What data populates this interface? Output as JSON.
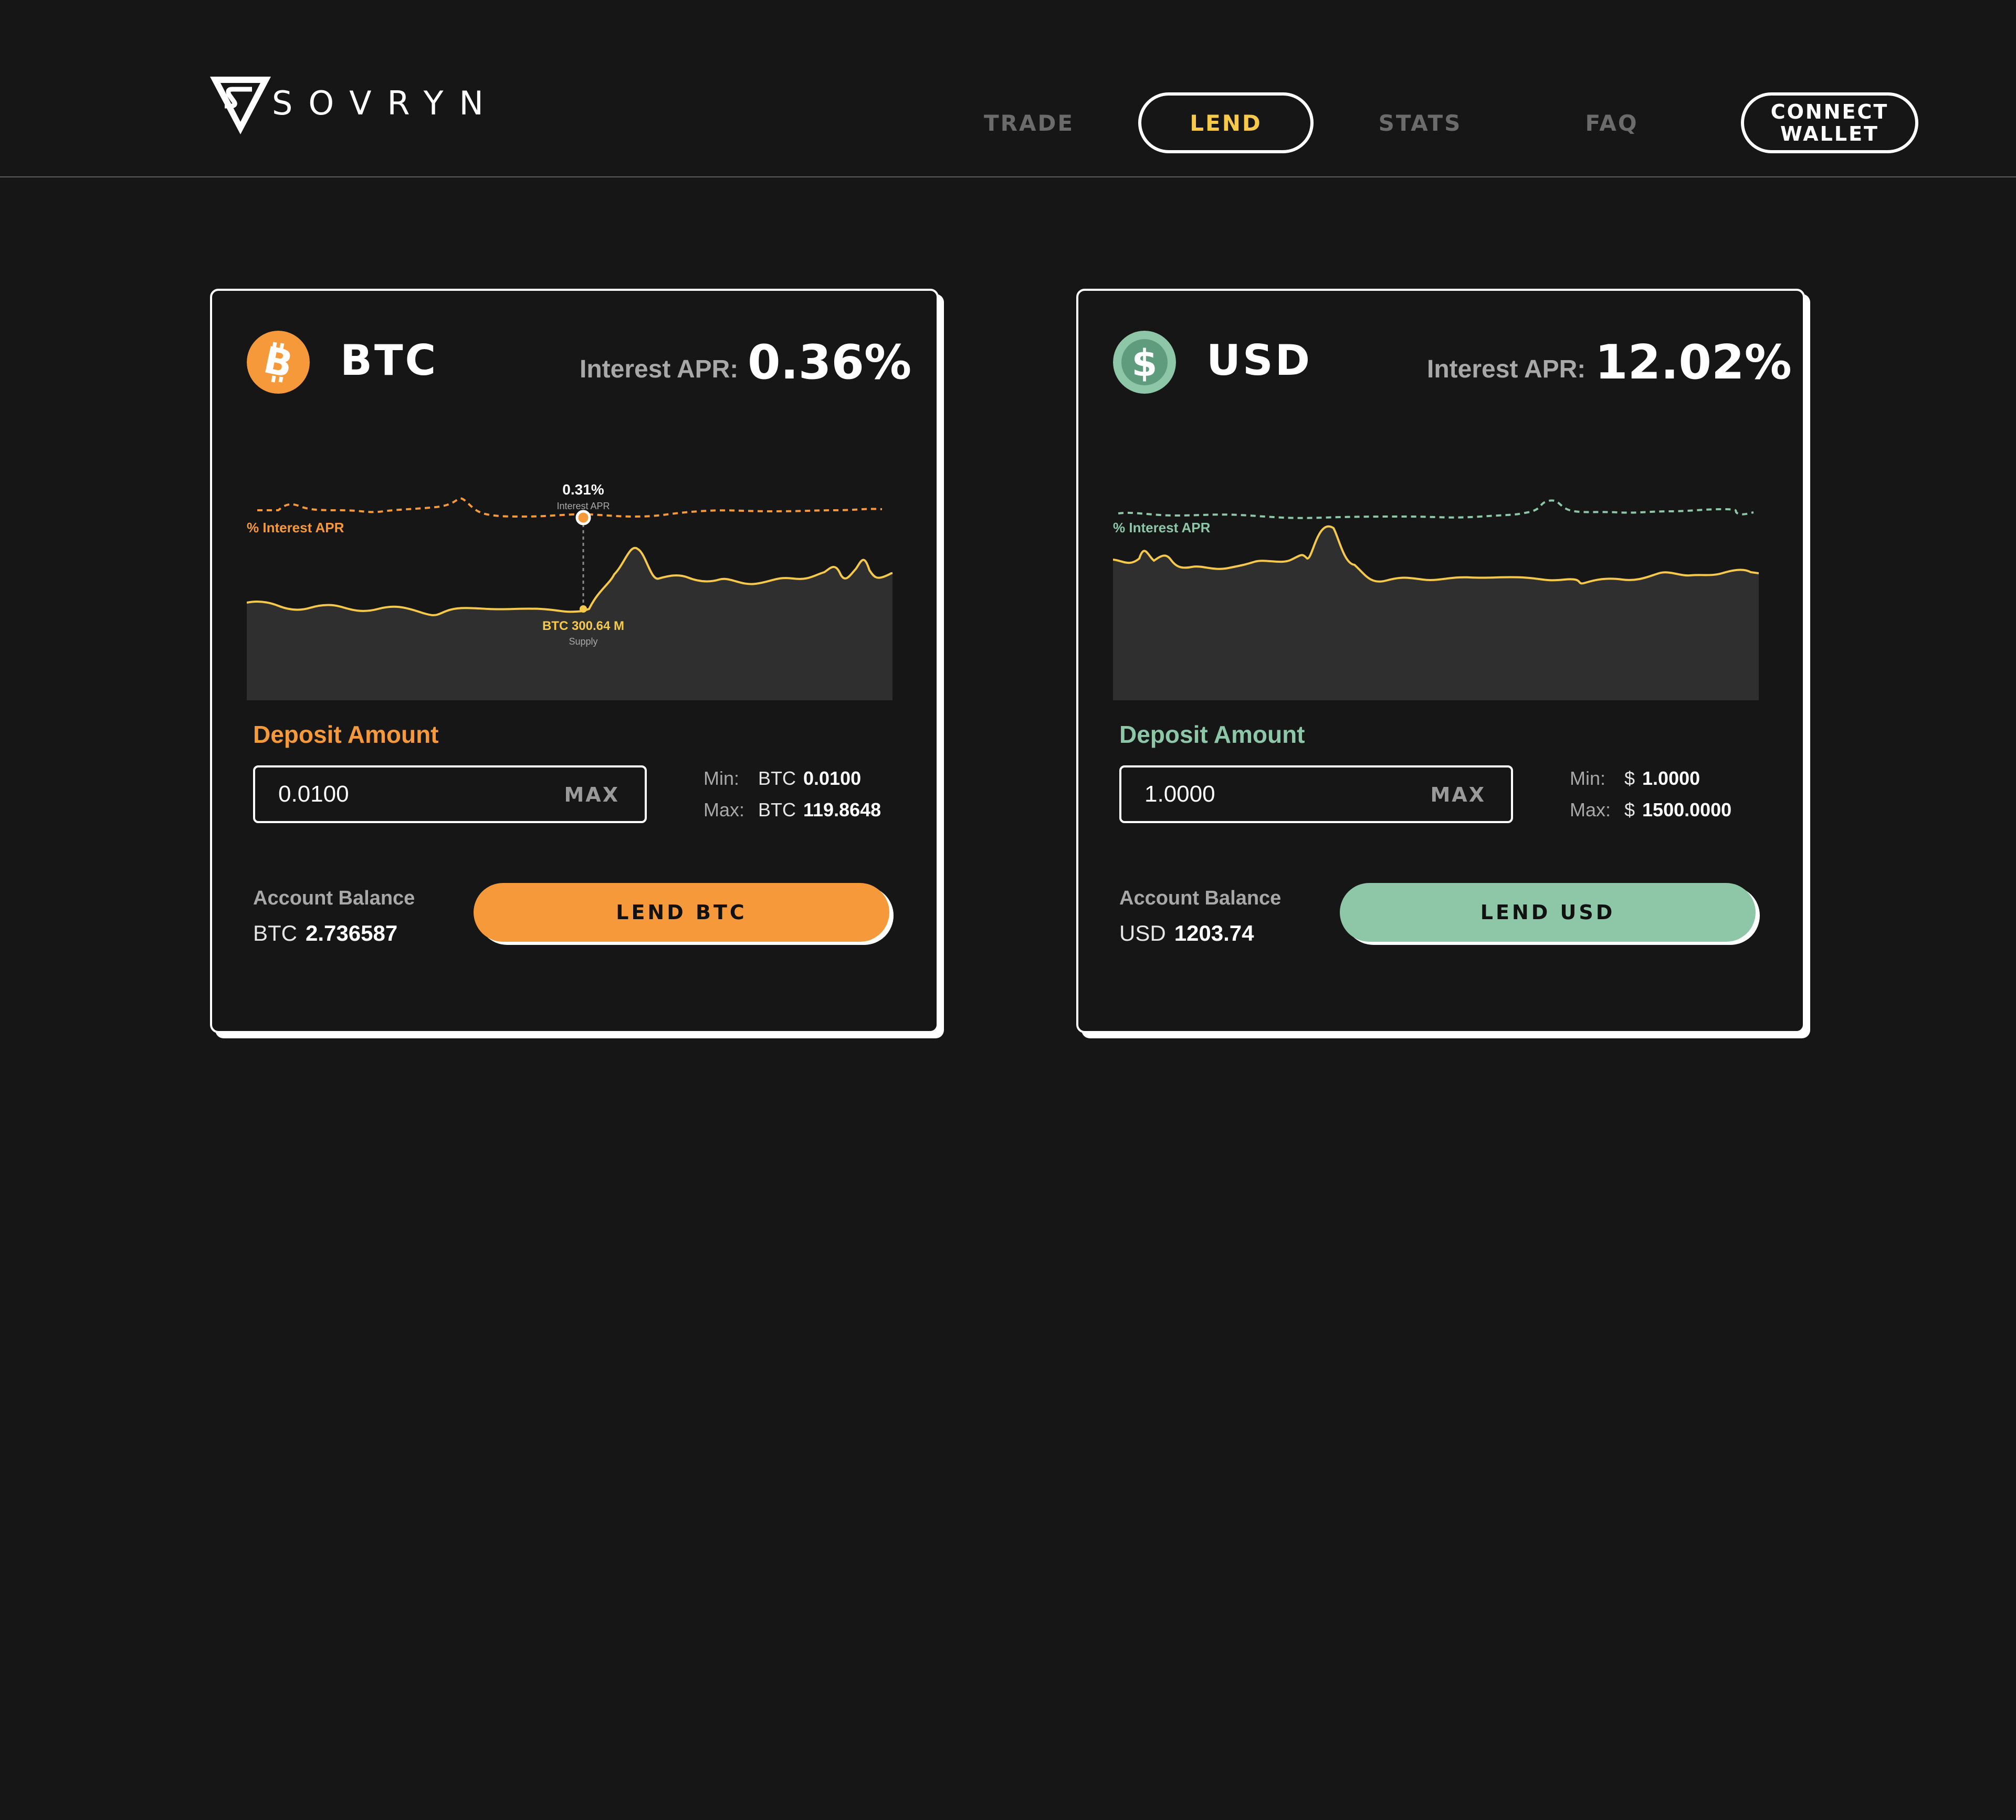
{
  "brand": {
    "name": "SOVRYN"
  },
  "nav": {
    "items": [
      {
        "label": "TRADE"
      },
      {
        "label": "LEND"
      },
      {
        "label": "STATS"
      },
      {
        "label": "FAQ"
      }
    ],
    "connect_line1": "CONNECT",
    "connect_line2": "WALLET"
  },
  "colors": {
    "btc_accent": "#f6993a",
    "usd_accent": "#8ec6a8",
    "chart_line": "#f7c94b",
    "background": "#161616"
  },
  "cards": [
    {
      "asset": "BTC",
      "icon": "bitcoin-icon",
      "apr_label": "Interest APR:",
      "apr_value": "0.36%",
      "chart": {
        "series_label": "% Interest APR",
        "tooltip_value": "0.31%",
        "tooltip_label": "Interest APR",
        "supply_value": "BTC 300.64 M",
        "supply_label": "Supply"
      },
      "deposit_label": "Deposit Amount",
      "input_value": "0.0100",
      "max_label": "MAX",
      "min_label": "Min:",
      "min_currency": "BTC",
      "min_value": "0.0100",
      "max_text_label": "Max:",
      "max_currency": "BTC",
      "max_value": "119.8648",
      "balance_label": "Account Balance",
      "balance_currency": "BTC",
      "balance_value": "2.736587",
      "lend_label": "LEND BTC"
    },
    {
      "asset": "USD",
      "icon": "dollar-icon",
      "apr_label": "Interest APR:",
      "apr_value": "12.02%",
      "chart": {
        "series_label": "% Interest APR"
      },
      "deposit_label": "Deposit Amount",
      "input_value": "1.0000",
      "max_label": "MAX",
      "min_label": "Min:",
      "min_currency": "$",
      "min_value": "1.0000",
      "max_text_label": "Max:",
      "max_currency": "$",
      "max_value": "1500.0000",
      "balance_label": "Account Balance",
      "balance_currency": "USD",
      "balance_value": "1203.74",
      "lend_label": "LEND USD"
    }
  ]
}
